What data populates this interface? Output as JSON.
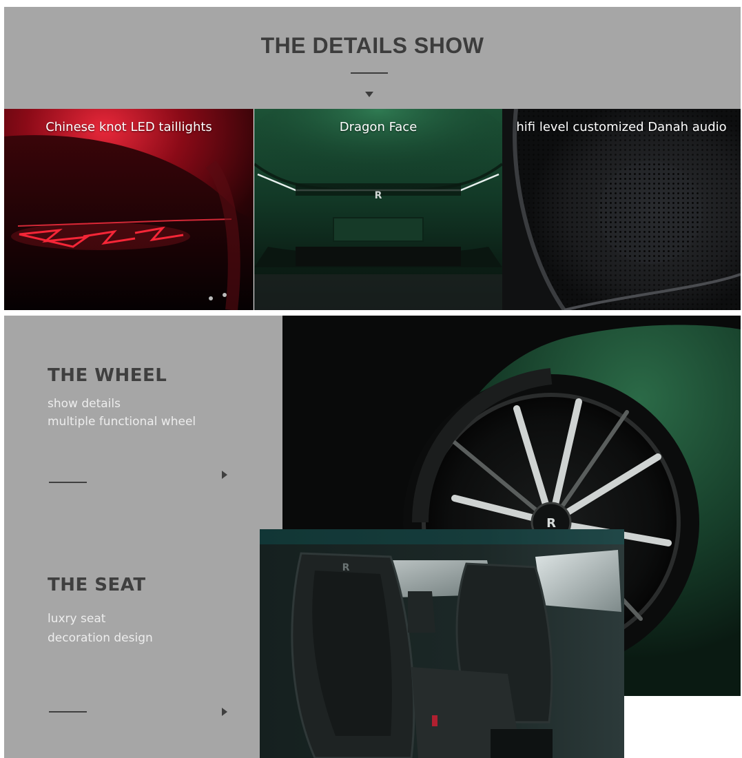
{
  "header": {
    "title": "THE DETAILS SHOW"
  },
  "panels": [
    {
      "caption": "Chinese knot LED taillights"
    },
    {
      "caption": "Dragon Face"
    },
    {
      "caption": "hifi level customized Danah audio"
    }
  ],
  "features": {
    "wheel": {
      "title": "THE WHEEL",
      "line1": "show  details",
      "line2": "multiple functional wheel"
    },
    "seat": {
      "title": "THE SEAT",
      "line1": "luxry seat",
      "line2": "decoration design"
    }
  },
  "colors": {
    "band_gray": "#a6a6a6",
    "heading_dark": "#3c3c3c",
    "taillight_red": "#e0142a",
    "body_green": "#1e4a33"
  },
  "icons": {
    "header_arrow": "triangle-down-icon",
    "feature_arrow": "triangle-right-icon"
  }
}
